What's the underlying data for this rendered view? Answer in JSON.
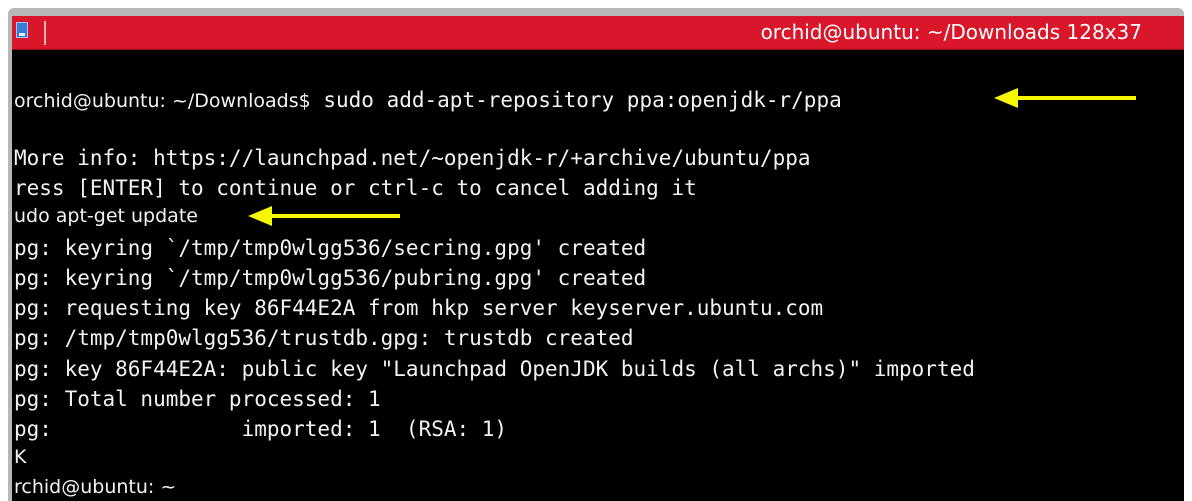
{
  "window": {
    "title": "orchid@ubuntu: ~/Downloads 128x37"
  },
  "prompt": {
    "text": "orchid@ubuntu: ~/Downloads$",
    "command": "sudo add-apt-repository ppa:openjdk-r/ppa"
  },
  "output": {
    "lines": [
      "More info: https://launchpad.net/~openjdk-r/+archive/ubuntu/ppa",
      "ress [ENTER] to continue or ctrl-c to cancel adding it",
      "udo apt-get update",
      "pg: keyring `/tmp/tmp0wlgg536/secring.gpg' created",
      "pg: keyring `/tmp/tmp0wlgg536/pubring.gpg' created",
      "pg: requesting key 86F44E2A from hkp server keyserver.ubuntu.com",
      "pg: /tmp/tmp0wlgg536/trustdb.gpg: trustdb created",
      "pg: key 86F44E2A: public key \"Launchpad OpenJDK builds (all archs)\" imported",
      "pg: Total number processed: 1",
      "pg:               imported: 1  (RSA: 1)",
      "K"
    ],
    "last_prompt": "rchid@ubuntu: ~"
  },
  "annotations": {
    "arrow_color": "#f7f700"
  },
  "colors": {
    "titlebar": "#d9162a",
    "background": "#000000",
    "text": "#f2f2f2"
  }
}
